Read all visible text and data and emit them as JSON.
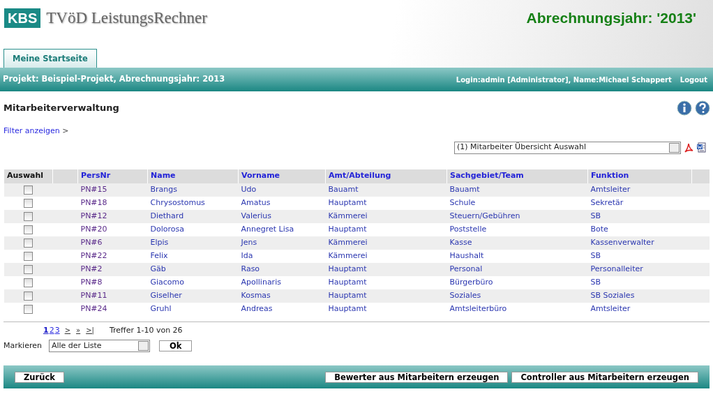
{
  "header": {
    "logo": "KBS",
    "app_title": "TVöD LeistungsRechner",
    "year_banner": "Abrechnungsjahr: '2013'"
  },
  "tabs": [
    {
      "label": "Meine Startseite",
      "selected": true
    }
  ],
  "project_bar": {
    "project": "Projekt: Beispiel-Projekt, Abrechnungsjahr: 2013",
    "login": "Login:admin [Administrator], Name:Michael Schappert",
    "logout": "Logout"
  },
  "page_title": "Mitarbeiterverwaltung",
  "filter_link": "Filter anzeigen",
  "filter_arrow": ">",
  "report_select": {
    "value": "(1) Mitarbeiter Übersicht Auswahl"
  },
  "table": {
    "columns": [
      "Auswahl",
      "",
      "PersNr",
      "Name",
      "Vorname",
      "Amt/Abteilung",
      "Sachgebiet/Team",
      "Funktion",
      ""
    ],
    "rows": [
      {
        "checked": false,
        "cells": [
          "",
          "",
          "PN#15",
          "Brangs",
          "Udo",
          "Bauamt",
          "Bauamt",
          "Amtsleiter"
        ]
      },
      {
        "checked": false,
        "cells": [
          "",
          "",
          "PN#18",
          "Chrysostomus",
          "Amatus",
          "Hauptamt",
          "Schule",
          "Sekretär"
        ]
      },
      {
        "checked": false,
        "cells": [
          "",
          "",
          "PN#12",
          "Diethard",
          "Valerius",
          "Kämmerei",
          "Steuern/Gebühren",
          "SB"
        ]
      },
      {
        "checked": false,
        "cells": [
          "",
          "",
          "PN#20",
          "Dolorosa",
          "Annegret Lisa",
          "Hauptamt",
          "Poststelle",
          "Bote"
        ]
      },
      {
        "checked": false,
        "cells": [
          "",
          "",
          "PN#6",
          "Elpis",
          "Jens",
          "Kämmerei",
          "Kasse",
          "Kassenverwalter"
        ]
      },
      {
        "checked": false,
        "cells": [
          "",
          "",
          "PN#22",
          "Felix",
          "Ida",
          "Kämmerei",
          "Haushalt",
          "SB"
        ]
      },
      {
        "checked": false,
        "cells": [
          "",
          "",
          "PN#2",
          "Gäb",
          "Raso",
          "Hauptamt",
          "Personal",
          "Personalleiter"
        ]
      },
      {
        "checked": false,
        "cells": [
          "",
          "",
          "PN#8",
          "Giacomo",
          "Apollinaris",
          "Hauptamt",
          "Bürgerbüro",
          "SB"
        ]
      },
      {
        "checked": false,
        "cells": [
          "",
          "",
          "PN#11",
          "Giselher",
          "Kosmas",
          "Hauptamt",
          "Soziales",
          "SB Soziales"
        ]
      },
      {
        "checked": false,
        "cells": [
          "",
          "",
          "PN#24",
          "Gruhl",
          "Andreas",
          "Hauptamt",
          "Amtsleiterbüro",
          "Amtsleiter"
        ]
      }
    ]
  },
  "pagination": {
    "pages": [
      {
        "label": "1",
        "selected": true
      },
      {
        "label": "2",
        "selected": false
      },
      {
        "label": "3",
        "selected": false
      }
    ],
    "nav": [
      ">",
      "»",
      ">|"
    ],
    "hits": "Treffer 1-10 von 26"
  },
  "mark": {
    "label": "Markieren",
    "value": "Alle der Liste",
    "button": "Ok"
  },
  "footer": {
    "left_buttons": [
      "Zurück"
    ],
    "right_buttons": [
      "Bewerter aus Mitarbeitern erzeugen",
      "Controller aus Mitarbeitern erzeugen"
    ]
  }
}
